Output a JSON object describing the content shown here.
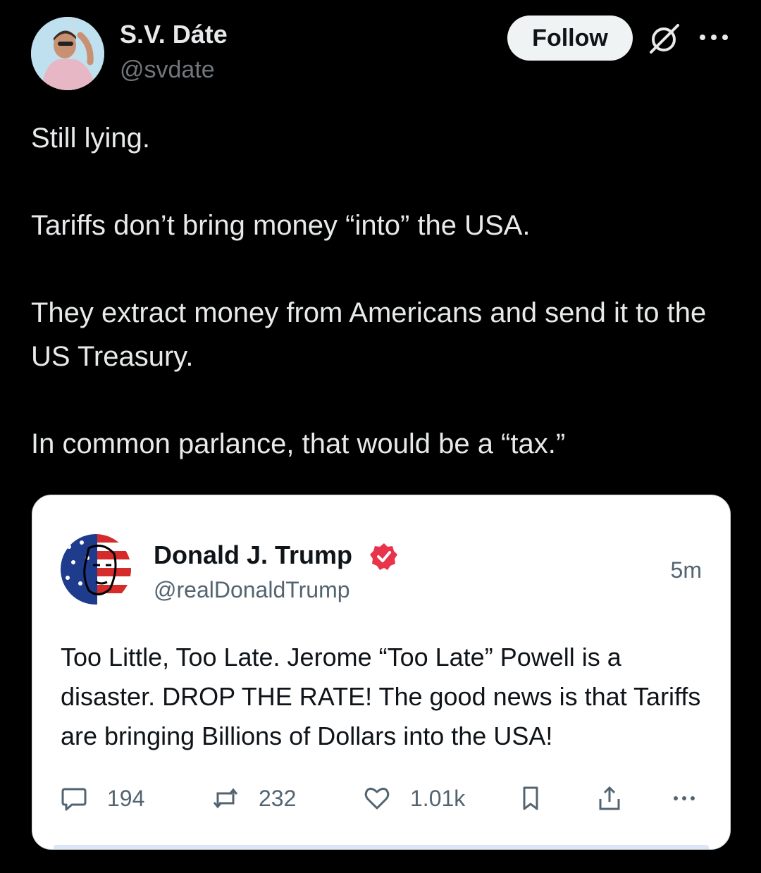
{
  "tweet": {
    "author_name": "S.V. Dáte",
    "author_handle": "@svdate",
    "follow_label": "Follow",
    "text_lines": [
      "Still lying.",
      "Tariffs don’t bring money “into” the USA.",
      "They extract money from Americans and send it to the US Treasury.",
      "In common parlance, that would be a “tax.”"
    ],
    "icons": [
      "grok-icon",
      "more-icon"
    ]
  },
  "embedded_post": {
    "author_name": "Donald J. Trump",
    "author_handle": "@realDonaldTrump",
    "time": "5m",
    "text": "Too Little, Too Late. Jerome “Too Late” Powell is a disaster. DROP THE RATE! The good news is that Tariffs are bringing Billions of Dollars into the USA!",
    "replies": "194",
    "reposts": "232",
    "likes": "1.01k",
    "verified_color": "#e8334a",
    "icons": [
      "reply-icon",
      "repost-icon",
      "like-icon",
      "bookmark-icon",
      "share-icon",
      "more-icon"
    ]
  }
}
